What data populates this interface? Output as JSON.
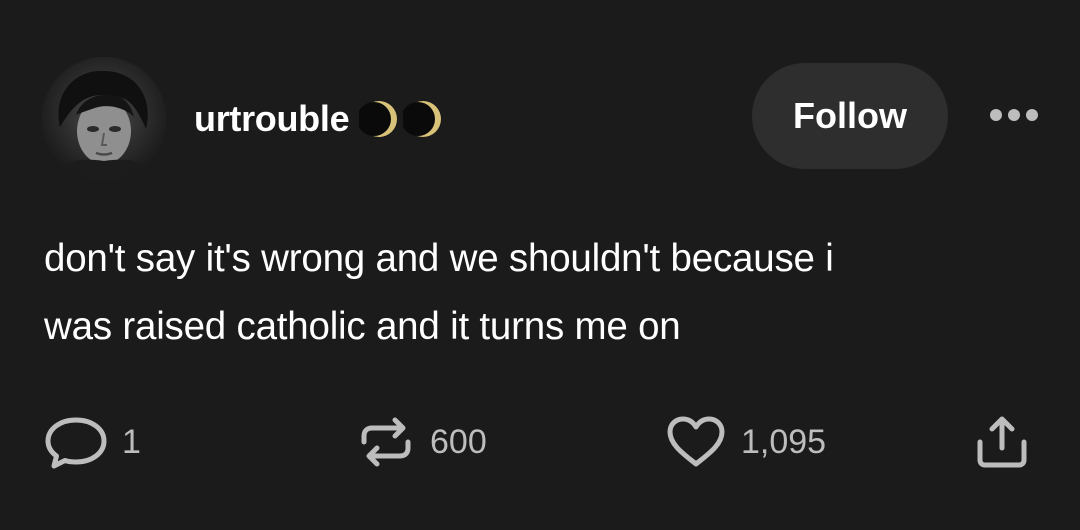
{
  "post": {
    "username": "urtrouble",
    "username_badges": [
      "moon-icon",
      "moon-icon"
    ],
    "follow_label": "Follow",
    "more_icon": "more-horizontal-icon",
    "text_lines": [
      "don't say it's wrong and we shouldn't because i",
      "was raised catholic and it turns me on"
    ]
  },
  "actions": {
    "comments": {
      "icon": "comment-icon",
      "count": "1"
    },
    "reblogs": {
      "icon": "reblog-icon",
      "count": "600"
    },
    "likes": {
      "icon": "heart-icon",
      "count": "1,095"
    },
    "share": {
      "icon": "share-icon"
    }
  },
  "colors": {
    "background": "#1b1b1b",
    "text": "#ffffff",
    "muted": "#bdbdbd",
    "follow_button_bg": "#2e2e2e",
    "moon_gold": "#d8c27a"
  }
}
